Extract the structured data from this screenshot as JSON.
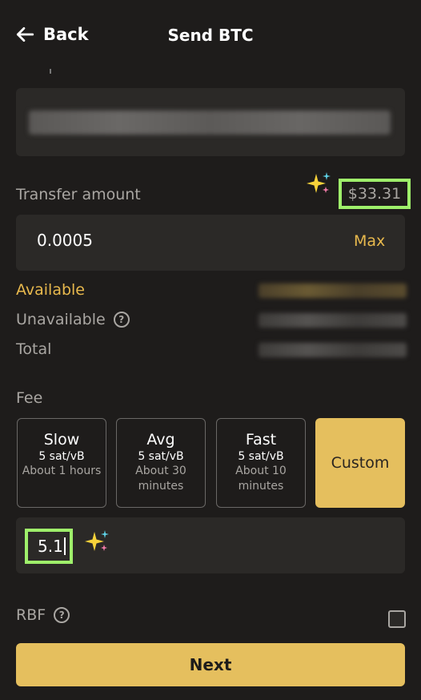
{
  "header": {
    "back_label": "Back",
    "title": "Send BTC"
  },
  "transfer": {
    "label": "Transfer amount",
    "usd_value": "$33.31",
    "amount": "0.0005",
    "max_label": "Max"
  },
  "balances": {
    "available_label": "Available",
    "unavailable_label": "Unavailable",
    "total_label": "Total"
  },
  "fee": {
    "label": "Fee",
    "options": [
      {
        "name": "Slow",
        "rate": "5 sat/vB",
        "time": "About 1 hours"
      },
      {
        "name": "Avg",
        "rate": "5 sat/vB",
        "time": "About 30 minutes"
      },
      {
        "name": "Fast",
        "rate": "5 sat/vB",
        "time": "About 10 minutes"
      }
    ],
    "custom_label": "Custom",
    "custom_value": "5.1"
  },
  "rbf": {
    "label": "RBF",
    "checked": false
  },
  "next_label": "Next",
  "colors": {
    "background": "#1e1c1b",
    "accent": "#e5bf5e",
    "highlight": "#9ff06b",
    "panel": "#2b2927"
  },
  "icons": {
    "back": "arrow-left-icon",
    "help": "question-circle-icon",
    "sparkle": "sparkle-icon"
  }
}
